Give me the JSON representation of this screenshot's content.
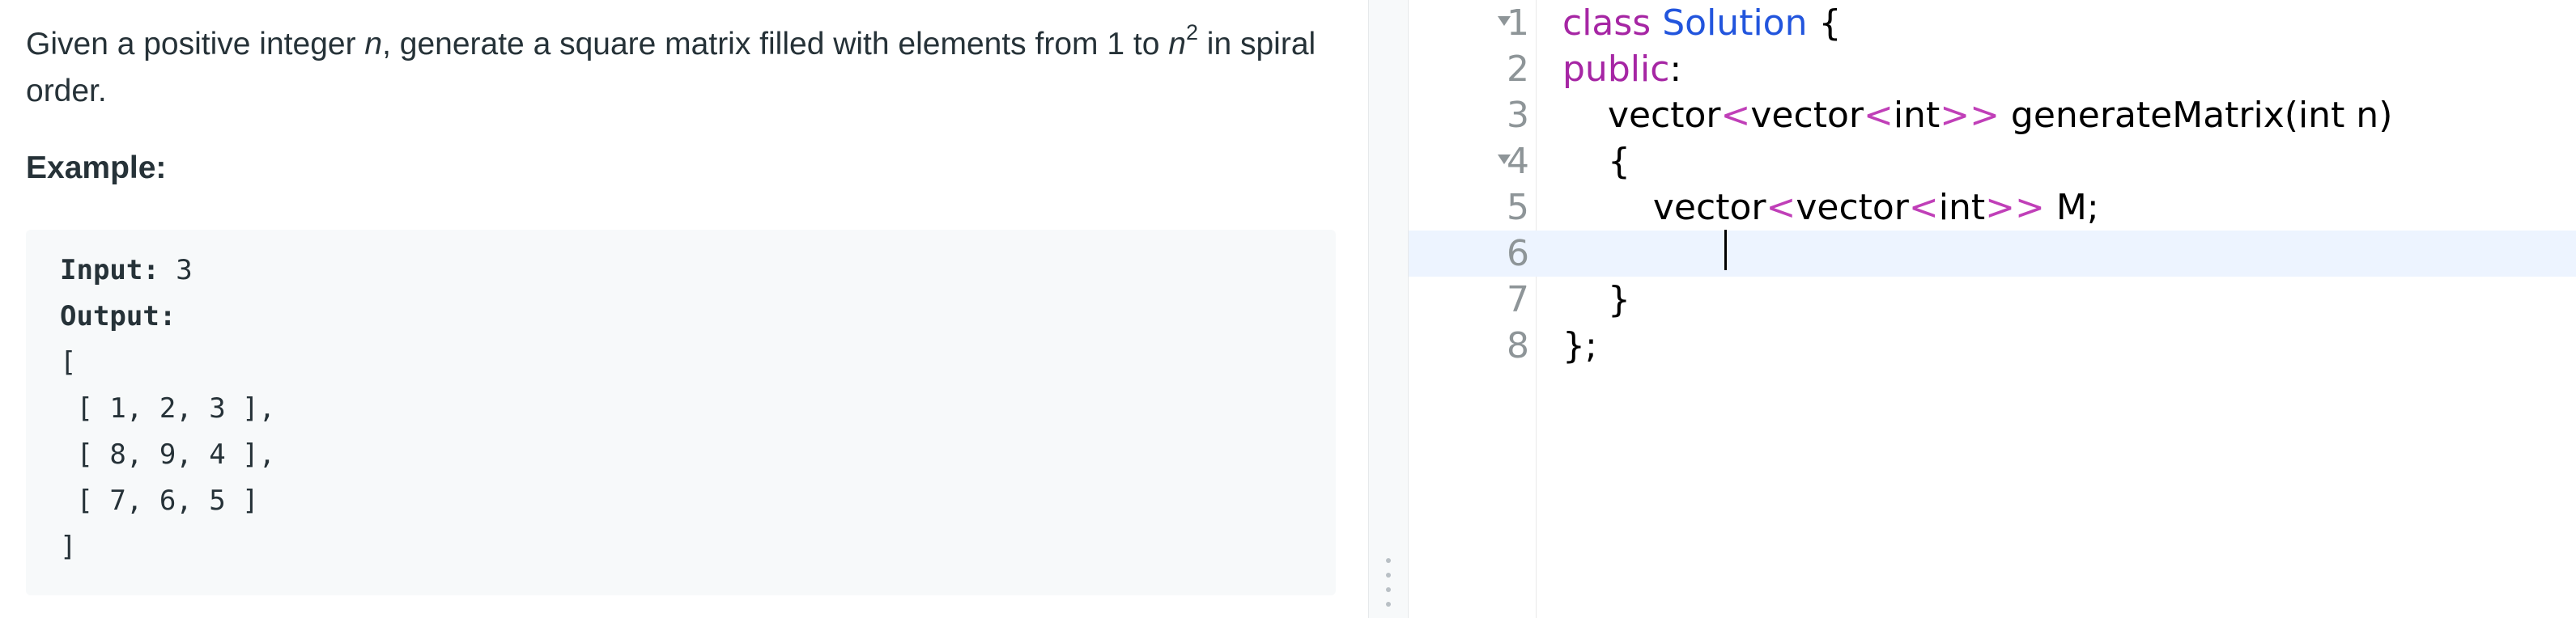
{
  "problem": {
    "text_before_n": "Given a positive integer ",
    "var_n": "n",
    "text_after_n": ", generate a square matrix filled with elements from 1 to ",
    "var_n2": "n",
    "exponent": "2",
    "text_end": " in spiral order.",
    "example_heading": "Example:",
    "example": {
      "input_label": "Input:",
      "input_value": " 3",
      "output_label": "Output:",
      "rows": [
        "[",
        " [ 1, 2, 3 ],",
        " [ 8, 9, 4 ],",
        " [ 7, 6, 5 ]",
        "]"
      ]
    }
  },
  "editor": {
    "active_line": 6,
    "lines": [
      {
        "num": "1",
        "fold": true,
        "tokens": [
          [
            "kw",
            "class"
          ],
          [
            "p",
            " "
          ],
          [
            "cls",
            "Solution"
          ],
          [
            "p",
            " {"
          ]
        ]
      },
      {
        "num": "2",
        "fold": false,
        "tokens": [
          [
            "kw",
            "public"
          ],
          [
            "p",
            ":"
          ]
        ]
      },
      {
        "num": "3",
        "fold": false,
        "tokens": [
          [
            "p",
            "    vector"
          ],
          [
            "ang",
            "<"
          ],
          [
            "p",
            "vector"
          ],
          [
            "ang",
            "<"
          ],
          [
            "p",
            "int"
          ],
          [
            "ang",
            ">>"
          ],
          [
            "p",
            " generateMatrix(int n)"
          ]
        ]
      },
      {
        "num": "4",
        "fold": true,
        "tokens": [
          [
            "p",
            "    {"
          ]
        ]
      },
      {
        "num": "5",
        "fold": false,
        "tokens": [
          [
            "p",
            "        vector"
          ],
          [
            "ang",
            "<"
          ],
          [
            "p",
            "vector"
          ],
          [
            "ang",
            "<"
          ],
          [
            "p",
            "int"
          ],
          [
            "ang",
            ">>"
          ],
          [
            "p",
            " M;"
          ]
        ]
      },
      {
        "num": "6",
        "fold": false,
        "tokens": [
          [
            "p",
            "        "
          ]
        ]
      },
      {
        "num": "7",
        "fold": false,
        "tokens": [
          [
            "p",
            "    }"
          ]
        ]
      },
      {
        "num": "8",
        "fold": false,
        "tokens": [
          [
            "p",
            "};"
          ]
        ]
      }
    ]
  },
  "colors": {
    "keyword": "#a626a4",
    "class_name": "#2255dd",
    "angle_brackets": "#c03fb8",
    "active_line_bg": "#edf4ff"
  }
}
